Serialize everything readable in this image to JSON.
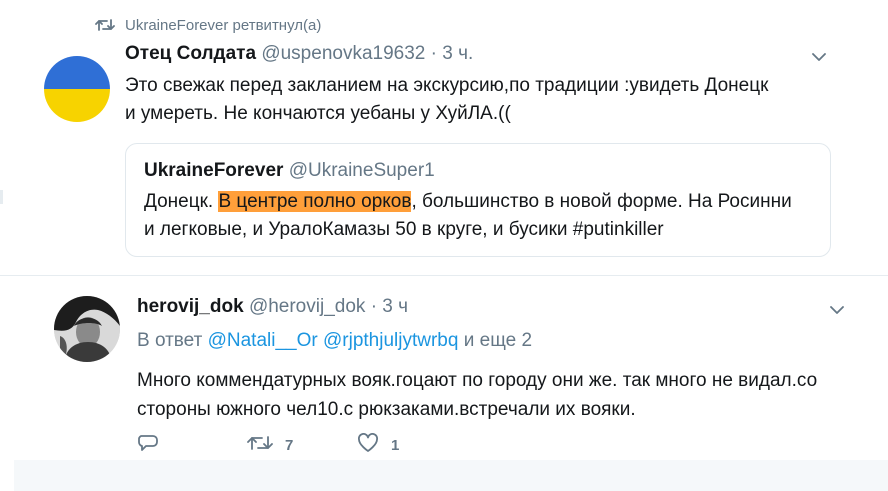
{
  "retweet": {
    "text": "UkraineForever ретвитнул(а)",
    "icon": "retweet-icon"
  },
  "tweet1": {
    "name": "Отец Солдата",
    "handle": "@uspenovka19632",
    "dot": "·",
    "time": "3 ч.",
    "line1": "Это свежак перед закланием на экскурсию,по традиции :увидеть Донецк",
    "line2": "и умереть. Не кончаются уебаны у ХуйЛА.((",
    "avatar_colors": [
      "#2f6fd6",
      "#f7d300"
    ]
  },
  "quote": {
    "name": "UkraineForever",
    "handle": "@UkraineSuper1",
    "text_before": "Донецк. ",
    "highlight": "В центре полно орков",
    "text_after": ", большинство в новой форме. На Росинни",
    "line2": "и легковые, и УралоКамазы 50 в круге, и бусики #putinkiller",
    "highlight_color": "#ff9f3a"
  },
  "tweet2": {
    "name": "herovij_dok",
    "handle": "@herovij_dok",
    "dot": "·",
    "time": "3 ч",
    "reply_prefix": "В ответ",
    "mention1": "@Natali__Or",
    "mention2": "@rjpthjuljytwrbq",
    "reply_suffix": "и еще 2",
    "line1": "Много коммендатурных вояк.гоцают по городу они же. так много не видал.со",
    "line2": "стороны южного чел10.с рюкзаками.встречали их вояки.",
    "retweet_count": "7",
    "like_count": "1"
  },
  "colors": {
    "link": "#1b95e0",
    "muted": "#657786",
    "text": "#14171a"
  }
}
